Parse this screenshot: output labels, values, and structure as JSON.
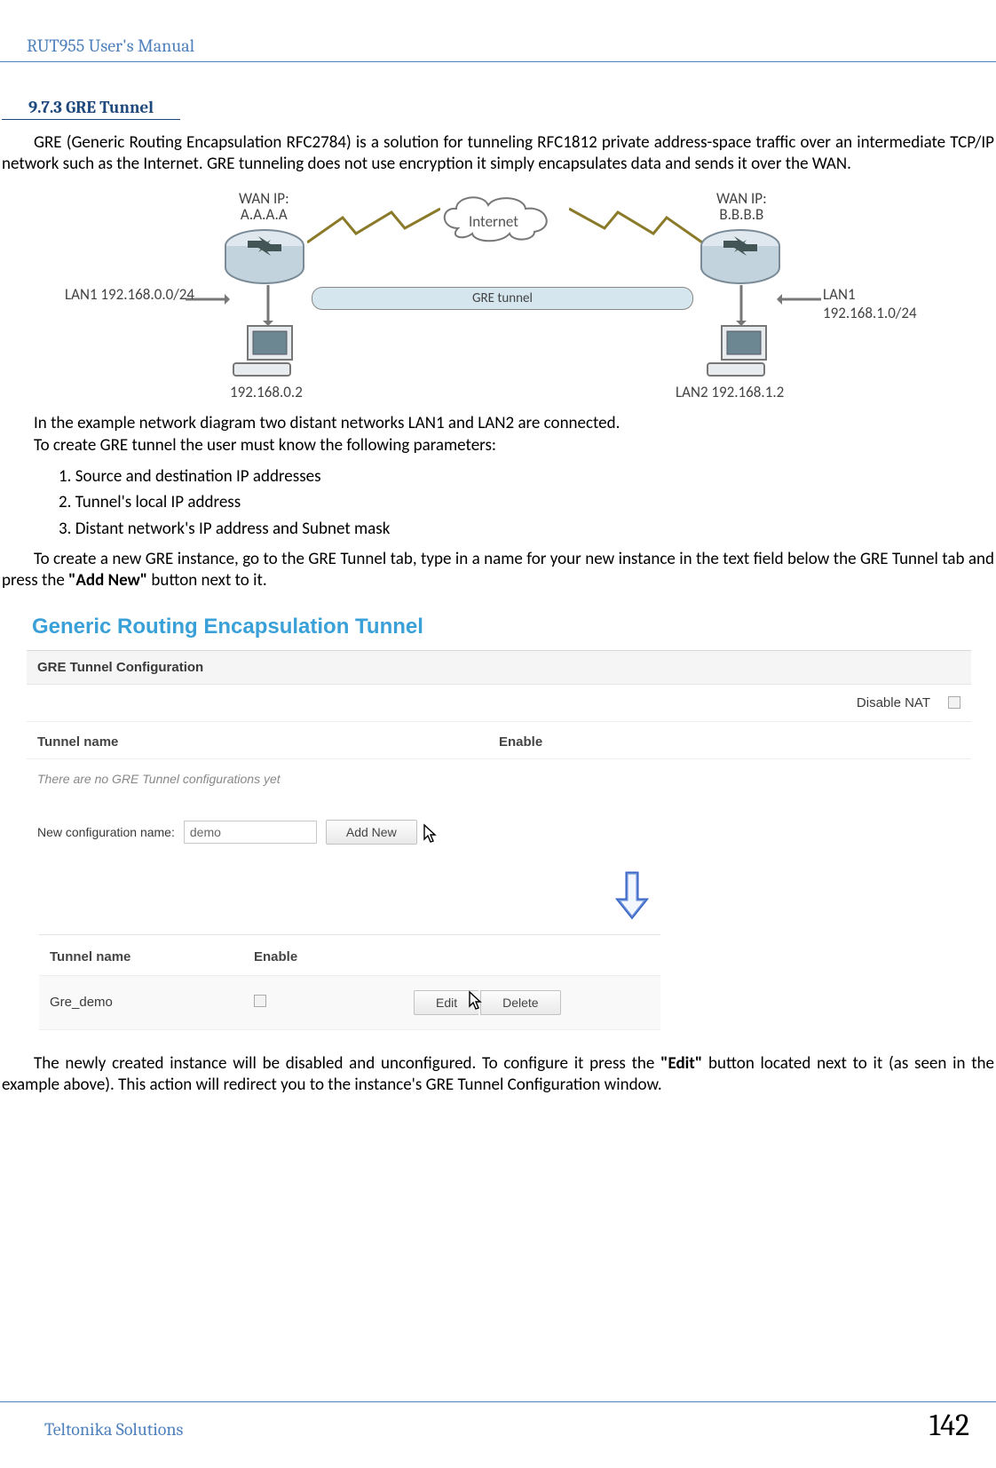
{
  "header": {
    "title": "RUT955 User's Manual"
  },
  "section": {
    "number": "9.7.3",
    "title": "GRE Tunnel"
  },
  "para1": "GRE (Generic Routing Encapsulation RFC2784) is a solution for tunneling RFC1812 private address-space traffic over an intermediate TCP/IP network such as the Internet. GRE tunneling does not use encryption it simply encapsulates data and sends it over the WAN.",
  "diagram": {
    "wan_a_label": "WAN IP:\nA.A.A.A",
    "wan_b_label": "WAN IP:\nB.B.B.B",
    "internet": "Internet",
    "tunnel": "GRE tunnel",
    "lan1": "LAN1 192.168.0.0/24",
    "lan1_host": "192.168.0.2",
    "lan2": "LAN1 192.168.1.0/24",
    "lan2_host": "LAN2 192.168.1.2"
  },
  "para2": "In the example network diagram two distant networks LAN1 and LAN2 are connected.",
  "para3": "To create GRE tunnel the user must know the following parameters:",
  "list": {
    "i1": "1. Source and destination IP addresses",
    "i2": "2. Tunnel's local IP address",
    "i3": "3. Distant network's IP address and Subnet mask"
  },
  "para4_a": "To create a new GRE instance, go to the GRE Tunnel tab, type in a name for your new instance in the text field below the GRE Tunnel tab and press the ",
  "para4_b": "\"Add New\"",
  "para4_c": " button next to it.",
  "ui": {
    "title": "Generic Routing Encapsulation Tunnel",
    "panel_header": "GRE Tunnel Configuration",
    "disable_nat": "Disable NAT",
    "col_name": "Tunnel name",
    "col_enable": "Enable",
    "empty": "There are no GRE Tunnel configurations yet",
    "new_cfg": "New configuration name:",
    "demo_value": "demo",
    "add_btn": "Add New",
    "row_name": "Gre_demo",
    "edit_btn": "Edit",
    "delete_btn": "Delete"
  },
  "para5_a": "The newly created instance will be disabled and unconfigured. To configure it press the ",
  "para5_b": "\"Edit\"",
  "para5_c": " button located next to it (as seen in the example above). This action will redirect you to the instance's GRE Tunnel Configuration window.",
  "footer": {
    "left": "Teltonika Solutions",
    "page": "142"
  }
}
